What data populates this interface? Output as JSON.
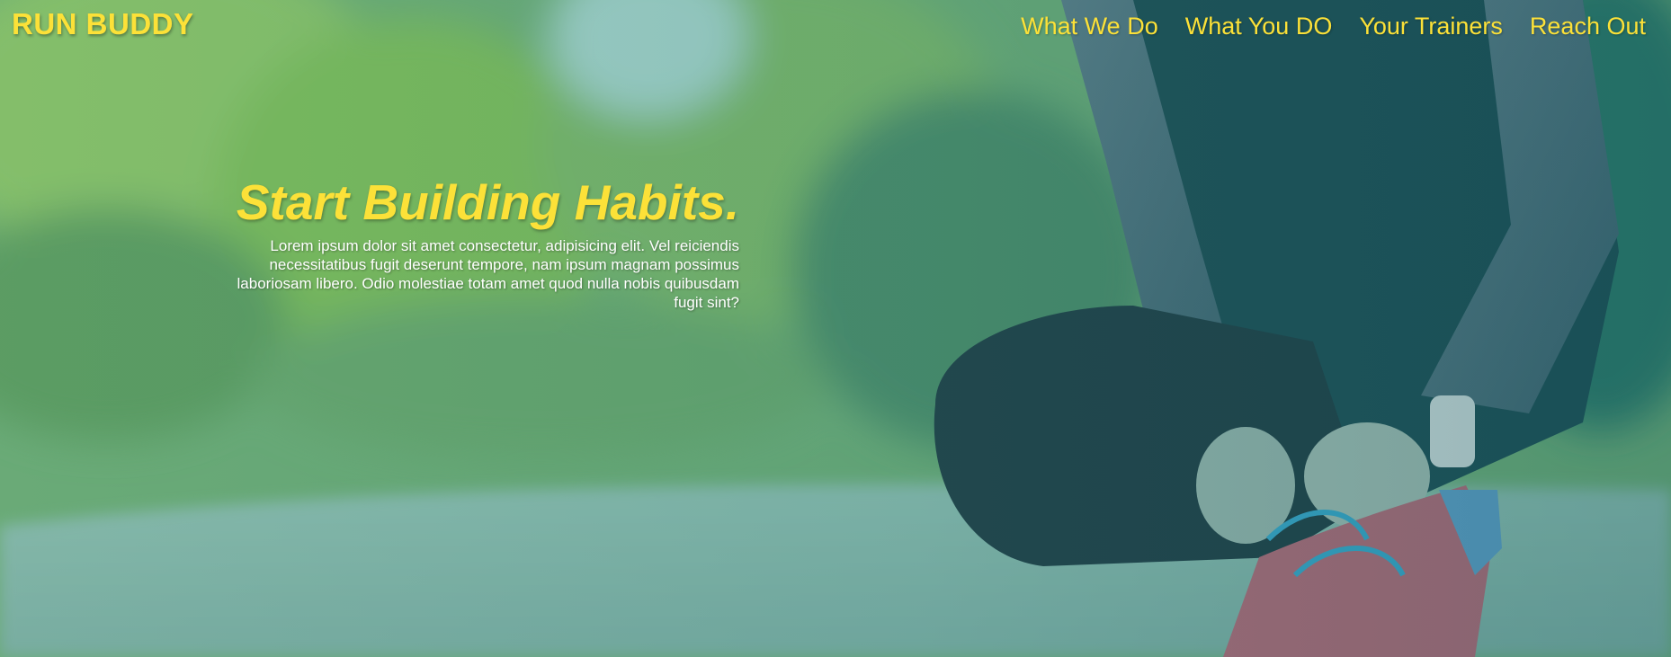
{
  "header": {
    "logo": "RUN BUDDY",
    "nav": [
      {
        "label": "What We Do"
      },
      {
        "label": "What You DO"
      },
      {
        "label": "Your Trainers"
      },
      {
        "label": "Reach Out"
      }
    ]
  },
  "hero": {
    "title": "Start Building Habits.",
    "body": "Lorem ipsum dolor sit amet consectetur, adipisicing elit. Vel reiciendis necessitatibus fugit deserunt tempore, nam ipsum magnam possimus laboriosam libero. Odio molestiae totam amet quod nulla nobis quibusdam fugit sint?"
  },
  "colors": {
    "accent": "#fce138",
    "body_text": "#ffffff",
    "overlay": "#2e8a8a"
  }
}
